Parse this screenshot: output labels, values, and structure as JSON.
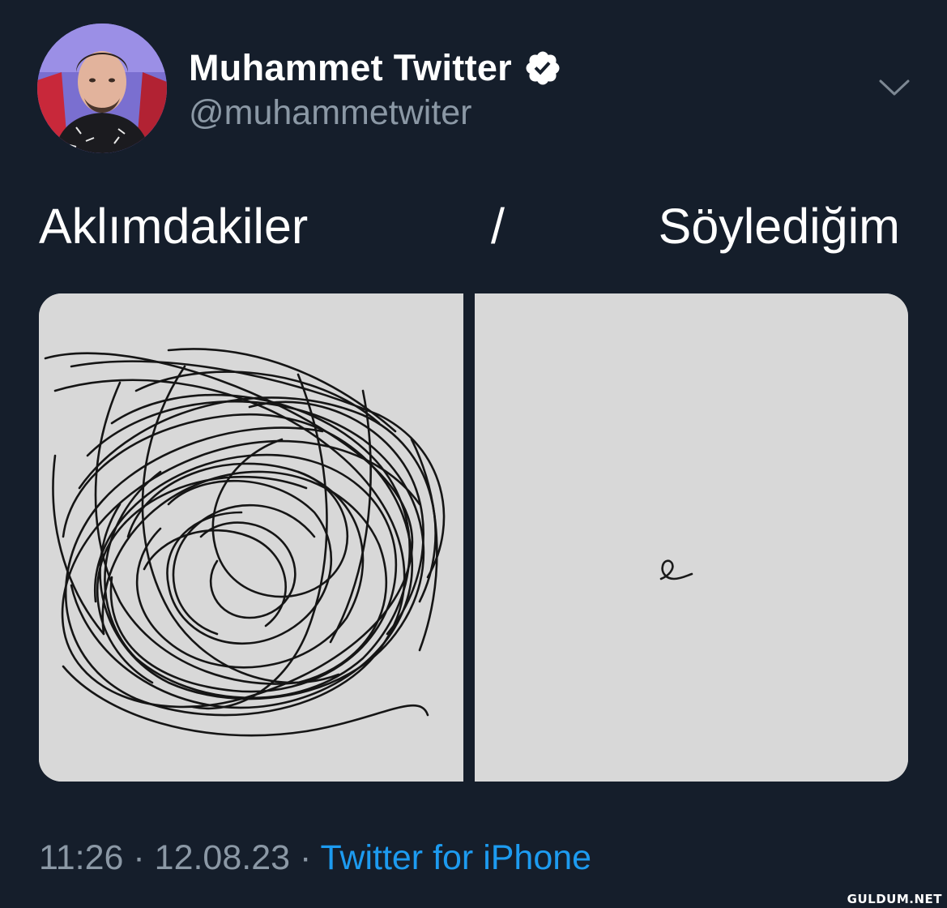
{
  "tweet": {
    "display_name": "Muhammet Twitter",
    "handle": "@muhammetwiter",
    "verified": true,
    "text": {
      "left": "Aklımdakiler",
      "separator": "/",
      "right": "Söylediğim"
    },
    "media": {
      "left_panel": "scribble-drawing",
      "right_panel": "single-letter-drawing",
      "right_letter": "e"
    },
    "meta": {
      "time": "11:26",
      "dot1": "·",
      "date": "12.08.23",
      "dot2": "·",
      "source": "Twitter for iPhone"
    },
    "menu_icon": "chevron-down-icon",
    "verified_icon": "verified-badge-icon"
  },
  "watermark": "GULDUM.NET",
  "colors": {
    "background": "#151e2b",
    "name": "#ffffff",
    "secondary": "#8b98a5",
    "link": "#1d9bf0",
    "verified_badge": "#ffffff"
  }
}
